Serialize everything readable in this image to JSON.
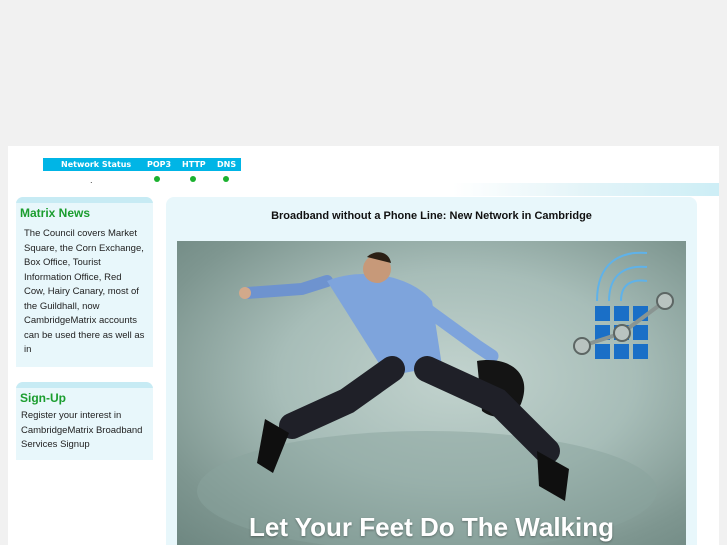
{
  "status": {
    "labels": [
      "Network Status",
      "POP3",
      "HTTP",
      "DNS"
    ],
    "indicator_color": "#1bb12f",
    "bar_color": "#00b5e6",
    "mark": "."
  },
  "news": {
    "title": "Matrix News",
    "text": "The Council covers Market Square, the Corn Exchange, Box Office, Tourist Information Office, Red Cow, Hairy Canary, most of the Guildhall, now CambridgeMatrix accounts can be used there as well as in"
  },
  "signup": {
    "title": "Sign-Up",
    "text": "Register your interest in CambridgeMatrix Broadband Services",
    "link": "Signup"
  },
  "main": {
    "title": "Broadband without a Phone Line: New Network in Cambridge",
    "hero_caption": "Let Your Feet Do The Walking",
    "logo_icon": "network-grid-logo-icon",
    "title_color": "#1a9d2e"
  }
}
